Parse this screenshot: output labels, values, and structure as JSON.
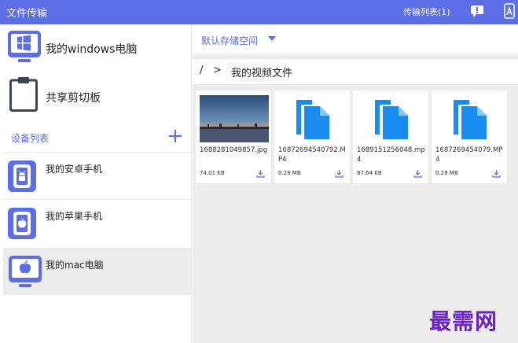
{
  "topbar": {
    "title": "文件传输",
    "transfer_list": "传输列表(1)"
  },
  "sidebar": {
    "pc": "我的windows电脑",
    "clipboard": "共享剪切板",
    "section_title": "设备列表",
    "devices": [
      {
        "label": "我的安卓手机",
        "icon": "android-phone-icon"
      },
      {
        "label": "我的苹果手机",
        "icon": "apple-phone-icon"
      },
      {
        "label": "我的mac电脑",
        "icon": "mac-computer-icon"
      }
    ]
  },
  "main": {
    "storage": "默认存储空间",
    "path": {
      "root": "/",
      "separator": ">",
      "folder": "我的视频文件"
    },
    "files": [
      {
        "name": "1688281049857.jpg",
        "size": "74.01 KB",
        "kind": "image"
      },
      {
        "name": "16872694540792.MP4",
        "size": "0.28 MB",
        "kind": "document"
      },
      {
        "name": "1689151256048.mp4",
        "size": "87.64 KB",
        "kind": "document"
      },
      {
        "name": "1687269454079.MP4",
        "size": "0.28 MB",
        "kind": "document"
      }
    ]
  },
  "watermark": "最需网",
  "colors": {
    "accent": "#5b6de7",
    "file_blue": "#1a8cf0",
    "watermark": "#6a23c2"
  }
}
